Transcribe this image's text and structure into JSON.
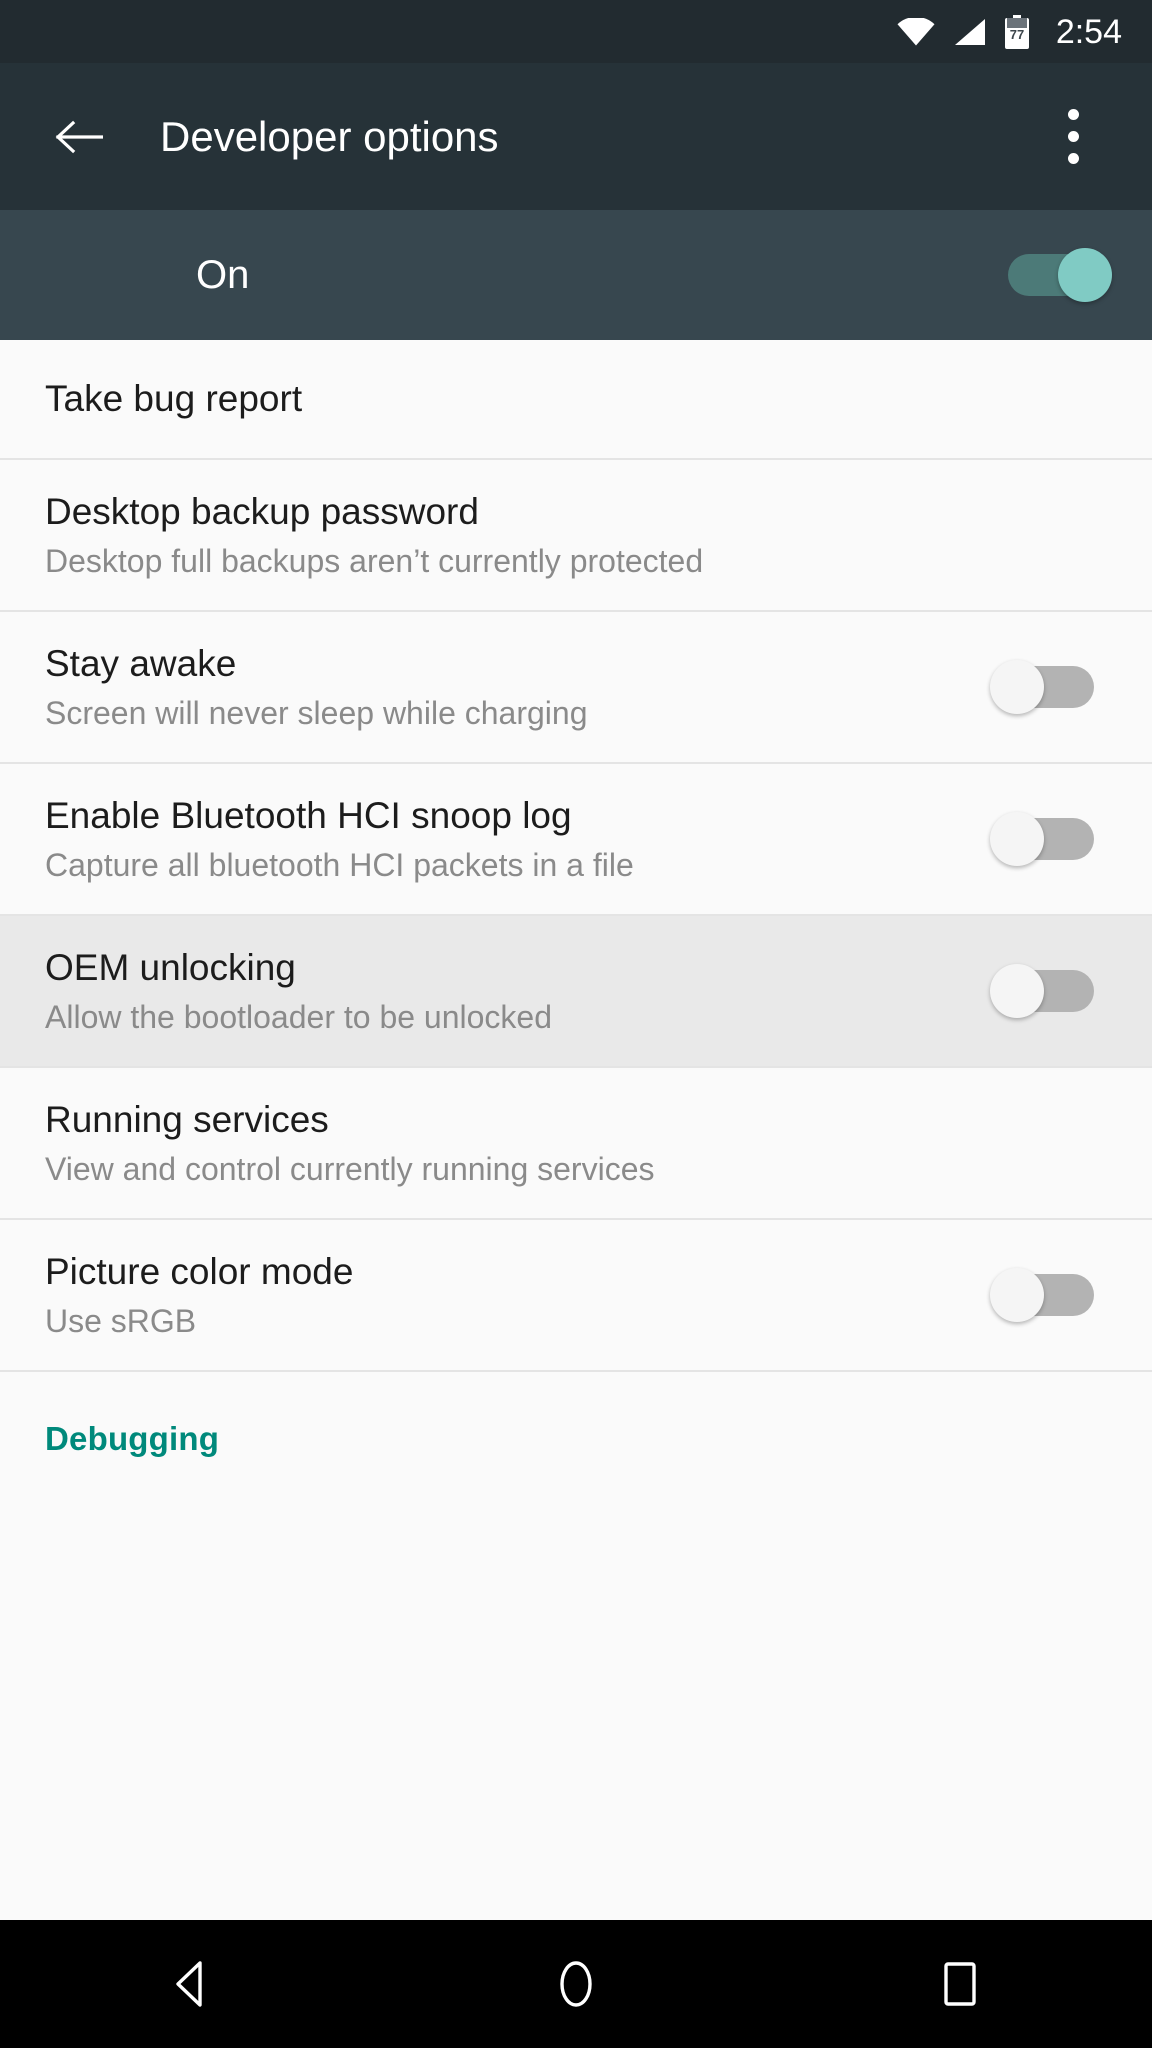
{
  "status_bar": {
    "wifi_icon": "wifi-icon",
    "cellular_icon": "cellular-signal-icon",
    "battery_icon": "battery-icon",
    "battery_level": "77",
    "time": "2:54"
  },
  "app_bar": {
    "back_icon": "back-arrow-icon",
    "title": "Developer options",
    "overflow_icon": "overflow-menu-icon"
  },
  "master_toggle": {
    "label": "On",
    "state": "on"
  },
  "colors": {
    "status_bar_bg": "#222b30",
    "app_bar_bg": "#263238",
    "master_row_bg": "#37474f",
    "row_bg": "#fafafa",
    "row_highlight_bg": "#e9e9e9",
    "accent_teal": "#00897b",
    "switch_on_thumb": "#80cbc4",
    "switch_on_track": "#4c7a78",
    "switch_off_thumb": "#f5f5f5",
    "switch_off_track": "#b3b3b3",
    "nav_bar_bg": "#000000"
  },
  "settings": [
    {
      "title": "Take bug report",
      "subtitle": "",
      "has_switch": false,
      "switch_state": "",
      "highlighted": false,
      "name": "setting-take-bug-report"
    },
    {
      "title": "Desktop backup password",
      "subtitle": "Desktop full backups aren’t currently protected",
      "has_switch": false,
      "switch_state": "",
      "highlighted": false,
      "name": "setting-desktop-backup-password"
    },
    {
      "title": "Stay awake",
      "subtitle": "Screen will never sleep while charging",
      "has_switch": true,
      "switch_state": "off",
      "highlighted": false,
      "name": "setting-stay-awake"
    },
    {
      "title": "Enable Bluetooth HCI snoop log",
      "subtitle": "Capture all bluetooth HCI packets in a file",
      "has_switch": true,
      "switch_state": "off",
      "highlighted": false,
      "name": "setting-bluetooth-hci-snoop-log"
    },
    {
      "title": "OEM unlocking",
      "subtitle": "Allow the bootloader to be unlocked",
      "has_switch": true,
      "switch_state": "off",
      "highlighted": true,
      "name": "setting-oem-unlocking"
    },
    {
      "title": "Running services",
      "subtitle": "View and control currently running services",
      "has_switch": false,
      "switch_state": "",
      "highlighted": false,
      "name": "setting-running-services"
    },
    {
      "title": "Picture color mode",
      "subtitle": "Use sRGB",
      "has_switch": true,
      "switch_state": "off",
      "highlighted": false,
      "name": "setting-picture-color-mode"
    }
  ],
  "section_header": {
    "title": "Debugging"
  },
  "nav_bar": {
    "back_icon": "nav-back-icon",
    "home_icon": "nav-home-icon",
    "recents_icon": "nav-recents-icon"
  }
}
